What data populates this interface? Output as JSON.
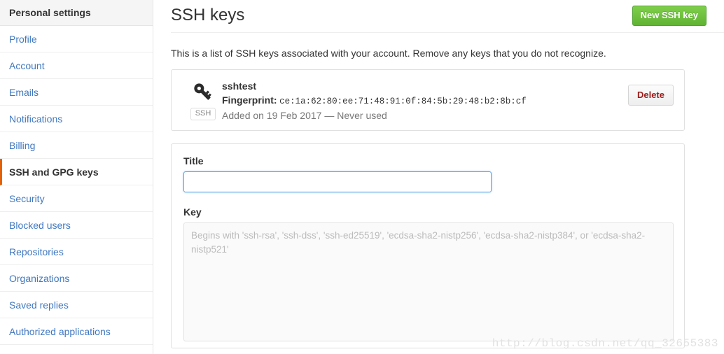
{
  "sidebar": {
    "header": "Personal settings",
    "items": [
      {
        "label": "Profile",
        "selected": false
      },
      {
        "label": "Account",
        "selected": false
      },
      {
        "label": "Emails",
        "selected": false
      },
      {
        "label": "Notifications",
        "selected": false
      },
      {
        "label": "Billing",
        "selected": false
      },
      {
        "label": "SSH and GPG keys",
        "selected": true
      },
      {
        "label": "Security",
        "selected": false
      },
      {
        "label": "Blocked users",
        "selected": false
      },
      {
        "label": "Repositories",
        "selected": false
      },
      {
        "label": "Organizations",
        "selected": false
      },
      {
        "label": "Saved replies",
        "selected": false
      },
      {
        "label": "Authorized applications",
        "selected": false
      }
    ]
  },
  "main": {
    "title": "SSH keys",
    "new_key_button": "New SSH key",
    "intro": "This is a list of SSH keys associated with your account. Remove any keys that you do not recognize."
  },
  "key_entry": {
    "icon_name": "key-icon",
    "badge": "SSH",
    "title": "sshtest",
    "fingerprint_label": "Fingerprint:",
    "fingerprint_value": "ce:1a:62:80:ee:71:48:91:0f:84:5b:29:48:b2:8b:cf",
    "meta": "Added on 19 Feb 2017 — Never used",
    "delete_button": "Delete"
  },
  "form": {
    "title_label": "Title",
    "title_value": "",
    "title_placeholder": "",
    "key_label": "Key",
    "key_value": "",
    "key_placeholder": "Begins with 'ssh-rsa', 'ssh-dss', 'ssh-ed25519', 'ecdsa-sha2-nistp256', 'ecdsa-sha2-nistp384', or 'ecdsa-sha2-nistp521'"
  },
  "watermark": "http://blog.csdn.net/qq_32655383",
  "colors": {
    "link": "#4078c0",
    "accent_selected": "#e36209",
    "button_green": "#60b433",
    "delete_red": "#9e1c1c",
    "input_focus_blue": "#4a9fe8"
  }
}
